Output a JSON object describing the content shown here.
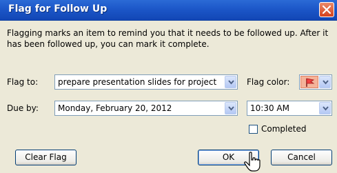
{
  "dialog": {
    "title": "Flag for Follow Up",
    "message": "Flagging marks an item to remind you that it needs to be followed up.  After it has been followed up, you can mark it complete."
  },
  "flag_to": {
    "label": "Flag to:",
    "value": "prepare presentation slides for project"
  },
  "flag_color": {
    "label": "Flag color:",
    "color": "#f04040"
  },
  "due_by": {
    "label": "Due by:",
    "date": "Monday, February 20, 2012",
    "time": "10:30 AM"
  },
  "completed": {
    "label": "Completed",
    "checked": false
  },
  "buttons": {
    "clear_flag": "Clear Flag",
    "ok": "OK",
    "cancel": "Cancel"
  },
  "icons": [
    "close-icon",
    "flag-icon",
    "chevron-down-icon",
    "mouse-cursor-icon"
  ]
}
